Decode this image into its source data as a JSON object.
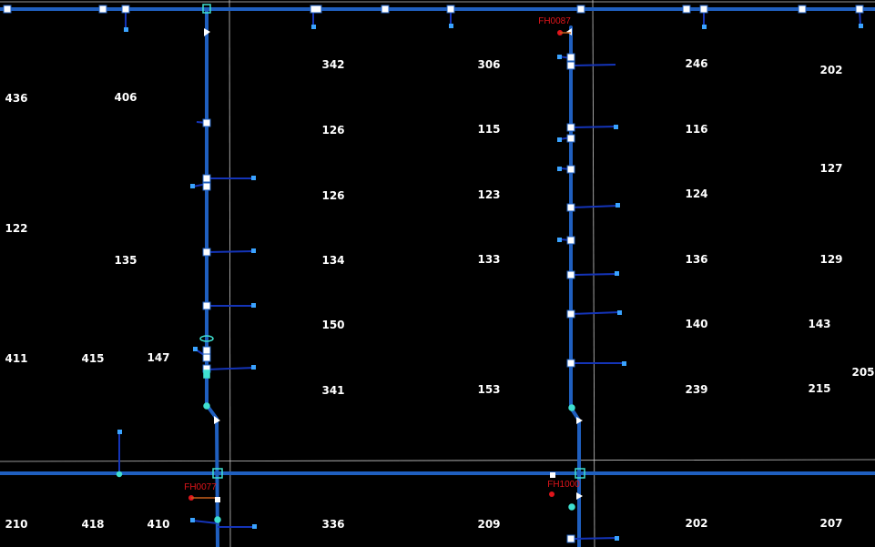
{
  "map": {
    "colors": {
      "background": "#000000",
      "water_main": "#1f5fbf",
      "service_line": "#1434b8",
      "valve": "#ffffff",
      "meter": "#3aa3ff",
      "fitting": "#3fe0d0",
      "parcel_line": "#c8c8c8",
      "hydrant": "#e0151b",
      "parcel_label": "#ffffff"
    },
    "parcel_labels": [
      "436",
      "406",
      "342",
      "306",
      "246",
      "202",
      "126",
      "115",
      "116",
      "127",
      "126",
      "123",
      "124",
      "122",
      "135",
      "134",
      "133",
      "136",
      "129",
      "150",
      "140",
      "143",
      "411",
      "415",
      "147",
      "205",
      "341",
      "153",
      "239",
      "215",
      "210",
      "418",
      "410",
      "336",
      "209",
      "202",
      "207"
    ],
    "hydrants": [
      "FH0087",
      "FH0077",
      "FH1000"
    ]
  }
}
